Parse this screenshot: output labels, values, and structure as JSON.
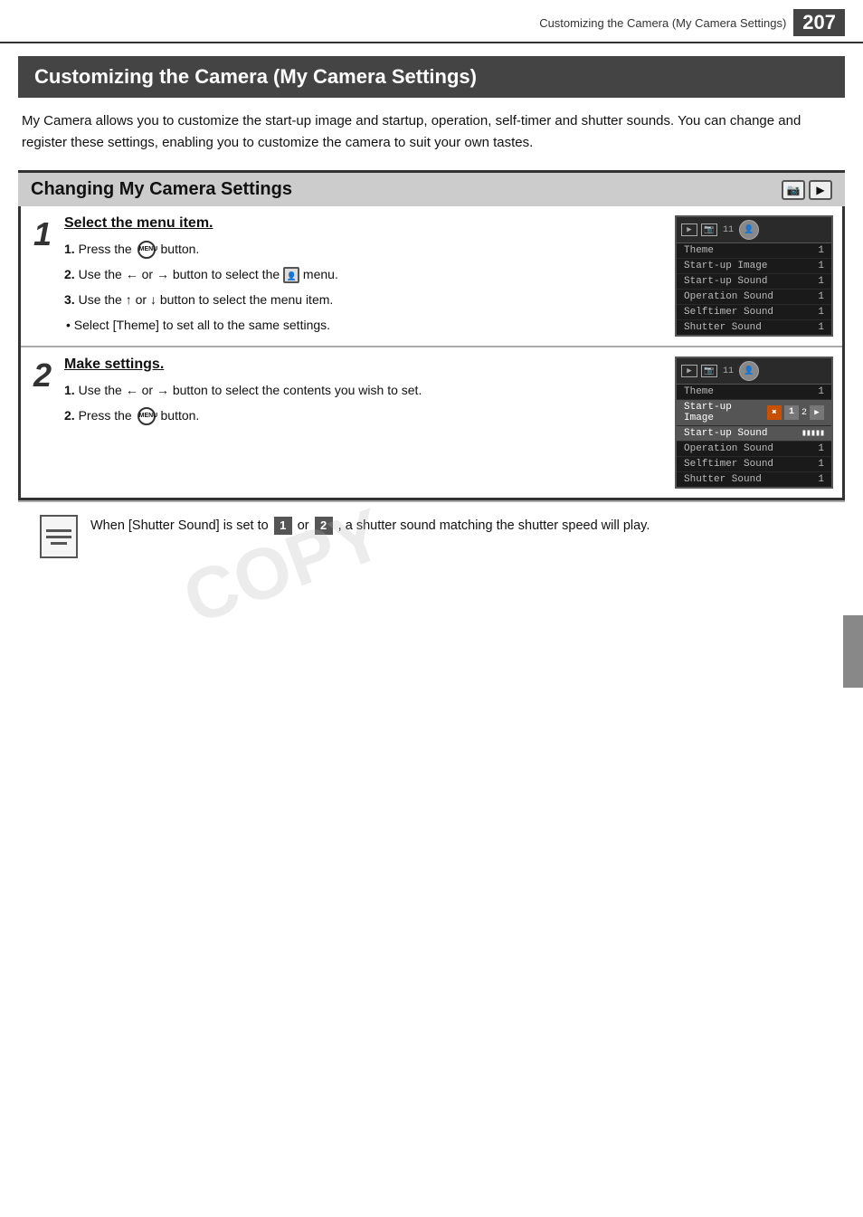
{
  "page": {
    "header_text": "Customizing the Camera (My Camera Settings)",
    "page_number": "207"
  },
  "main_title": "Customizing the Camera (My Camera Settings)",
  "intro": "My Camera allows you to customize the start-up image and startup, operation, self-timer and shutter sounds. You can change and register these settings, enabling you to customize the camera to suit your own tastes.",
  "section": {
    "title": "Changing My Camera Settings"
  },
  "steps": [
    {
      "number": "1",
      "title": "Select the menu item.",
      "instructions": [
        "1. Press the   button.",
        "2. Use the ← or → button to select the   menu.",
        "3. Use the ▲ or ▼ button to select the menu item."
      ],
      "note": "• Select [Theme] to set all to the same settings."
    },
    {
      "number": "2",
      "title": "Make settings.",
      "instructions": [
        "1. Use the ← or → button to select the contents you wish to set.",
        "2. Press the   button."
      ]
    }
  ],
  "menu_items": [
    "Theme",
    "Start-up Image",
    "Start-up Sound",
    "Operation Sound",
    "Selftimer Sound",
    "Shutter Sound"
  ],
  "menu_values": [
    "1",
    "1",
    "1",
    "1",
    "1",
    "1"
  ],
  "note_text": "When [Shutter Sound] is set to  1  or  2 , a shutter sound matching the shutter speed will play.",
  "watermark": "COPY"
}
